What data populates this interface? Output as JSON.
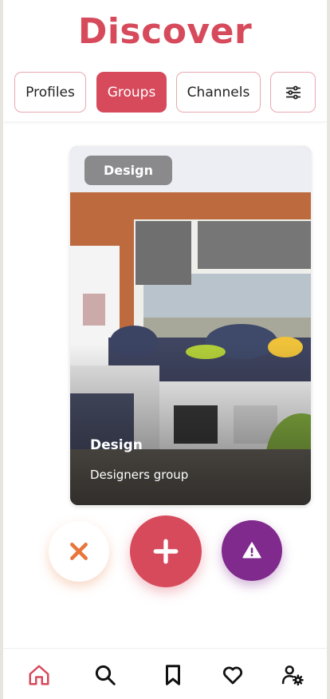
{
  "header": {
    "title": "Discover"
  },
  "tabs": [
    {
      "label": "Profiles",
      "active": false
    },
    {
      "label": "Groups",
      "active": true
    },
    {
      "label": "Channels",
      "active": false
    }
  ],
  "filter_button": {
    "icon": "sliders-icon"
  },
  "card": {
    "badge": "Design",
    "name": "Design",
    "description": "Designers group"
  },
  "actions": [
    {
      "name": "skip",
      "icon": "close-icon",
      "color": "#e8753a"
    },
    {
      "name": "add",
      "icon": "plus-icon",
      "color": "#d64a5c"
    },
    {
      "name": "report",
      "icon": "warning-icon",
      "color": "#7f2a8c"
    }
  ],
  "bottom_nav": [
    {
      "icon": "home-icon",
      "active": true
    },
    {
      "icon": "search-icon",
      "active": false
    },
    {
      "icon": "bookmark-icon",
      "active": false
    },
    {
      "icon": "heart-icon",
      "active": false
    },
    {
      "icon": "user-settings-icon",
      "active": false
    }
  ],
  "colors": {
    "accent": "#d64a5c",
    "purple": "#7f2a8c",
    "orange": "#e8753a"
  }
}
